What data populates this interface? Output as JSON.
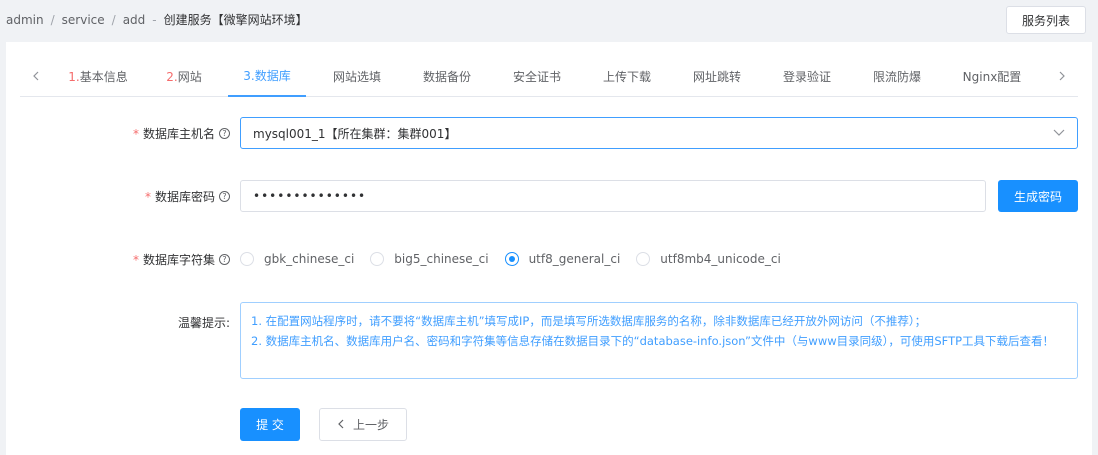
{
  "breadcrumb": {
    "items": [
      "admin",
      "service",
      "add"
    ],
    "separator": "/",
    "dash": "-",
    "title": "创建服务【微擎网站环境】"
  },
  "header": {
    "service_list_label": "服务列表"
  },
  "tabs": [
    {
      "num": "1.",
      "label": "基本信息"
    },
    {
      "num": "2.",
      "label": "网站"
    },
    {
      "num": "3.",
      "label": "数据库"
    },
    {
      "num": "",
      "label": "网站选填"
    },
    {
      "num": "",
      "label": "数据备份"
    },
    {
      "num": "",
      "label": "安全证书"
    },
    {
      "num": "",
      "label": "上传下载"
    },
    {
      "num": "",
      "label": "网址跳转"
    },
    {
      "num": "",
      "label": "登录验证"
    },
    {
      "num": "",
      "label": "限流防爆"
    },
    {
      "num": "",
      "label": "Nginx配置"
    }
  ],
  "active_tab": 2,
  "form": {
    "host": {
      "label": "数据库主机名",
      "value": "mysql001_1【所在集群：集群001】"
    },
    "password": {
      "label": "数据库密码",
      "value": "••••••••••••••",
      "generate_label": "生成密码"
    },
    "charset": {
      "label": "数据库字符集",
      "options": [
        "gbk_chinese_ci",
        "big5_chinese_ci",
        "utf8_general_ci",
        "utf8mb4_unicode_ci"
      ],
      "selected": 2
    },
    "tip": {
      "label": "温馨提示:",
      "line1": "1. 在配置网站程序时，请不要将“数据库主机”填写成IP，而是填写所选数据库服务的名称，除非数据库已经开放外网访问（不推荐）；",
      "line2": "2. 数据库主机名、数据库用户名、密码和字符集等信息存储在数据目录下的“database-info.json”文件中（与www目录同级），可使用SFTP工具下载后查看！"
    },
    "submit_label": "提 交",
    "prev_label": "上一步"
  },
  "colors": {
    "primary": "#1890ff",
    "required": "#f56c6c",
    "tip_text": "#409eff"
  }
}
